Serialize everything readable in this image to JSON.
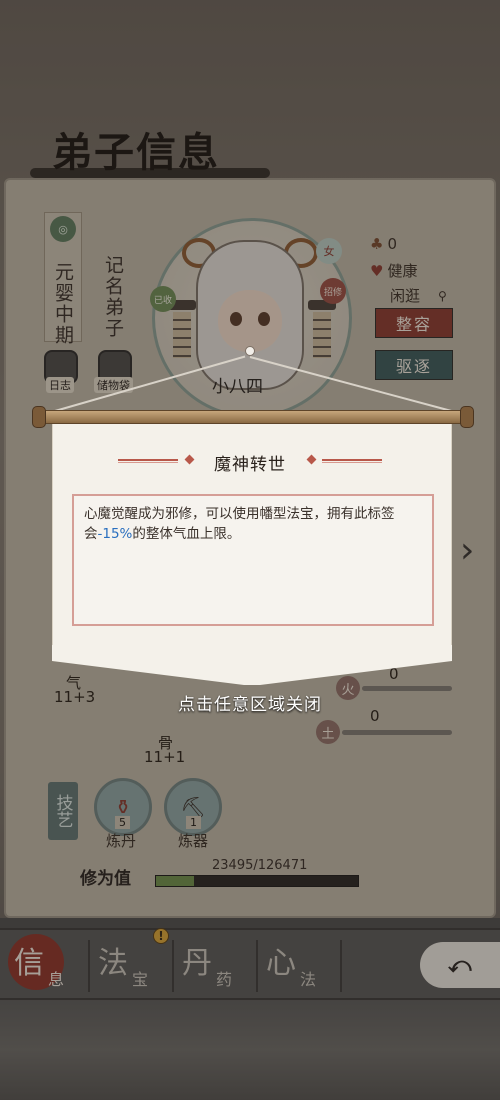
{
  "header": {
    "title": "弟子信息"
  },
  "profile": {
    "realm": "元婴中期",
    "rank": "记名弟子",
    "name": "小八四",
    "gender": "女",
    "sect_badge": "已收",
    "role_badge": "招修",
    "buttons": {
      "diary": "日志",
      "bag": "储物袋"
    }
  },
  "status": {
    "count": "0",
    "health": "健康",
    "activity": "闲逛",
    "makeover_button": "整容",
    "expel_button": "驱逐"
  },
  "stats": {
    "qi_label": "气",
    "qi_value": "11+3",
    "bone_label": "骨",
    "bone_value": "11+1",
    "elements": [
      {
        "name": "火",
        "value": "0"
      },
      {
        "name": "土",
        "value": "0"
      }
    ]
  },
  "skills": {
    "tag": "技艺",
    "items": [
      {
        "label": "炼丹",
        "count": "5"
      },
      {
        "label": "炼器",
        "count": "1"
      }
    ]
  },
  "cultivation": {
    "label": "修为值",
    "value": "23495/126471",
    "progress": 0.186
  },
  "modal": {
    "title": "魔神转世",
    "description_pre": "心魔觉醒成为邪修，可以使用幡型法宝，拥有此标签会",
    "description_highlight": "-15%",
    "description_post": "的整体气血上限。",
    "close_hint": "点击任意区域关闭"
  },
  "bottom_nav": {
    "tabs": [
      {
        "big": "信",
        "small": "息"
      },
      {
        "big": "法",
        "small": "宝"
      },
      {
        "big": "丹",
        "small": "药"
      },
      {
        "big": "心",
        "small": "法"
      }
    ],
    "badge": "!",
    "back": "⤺"
  },
  "colors": {
    "accent_red": "#8a3a2e",
    "accent_teal": "#3d5a5a",
    "highlight_blue": "#2a6fbf"
  }
}
